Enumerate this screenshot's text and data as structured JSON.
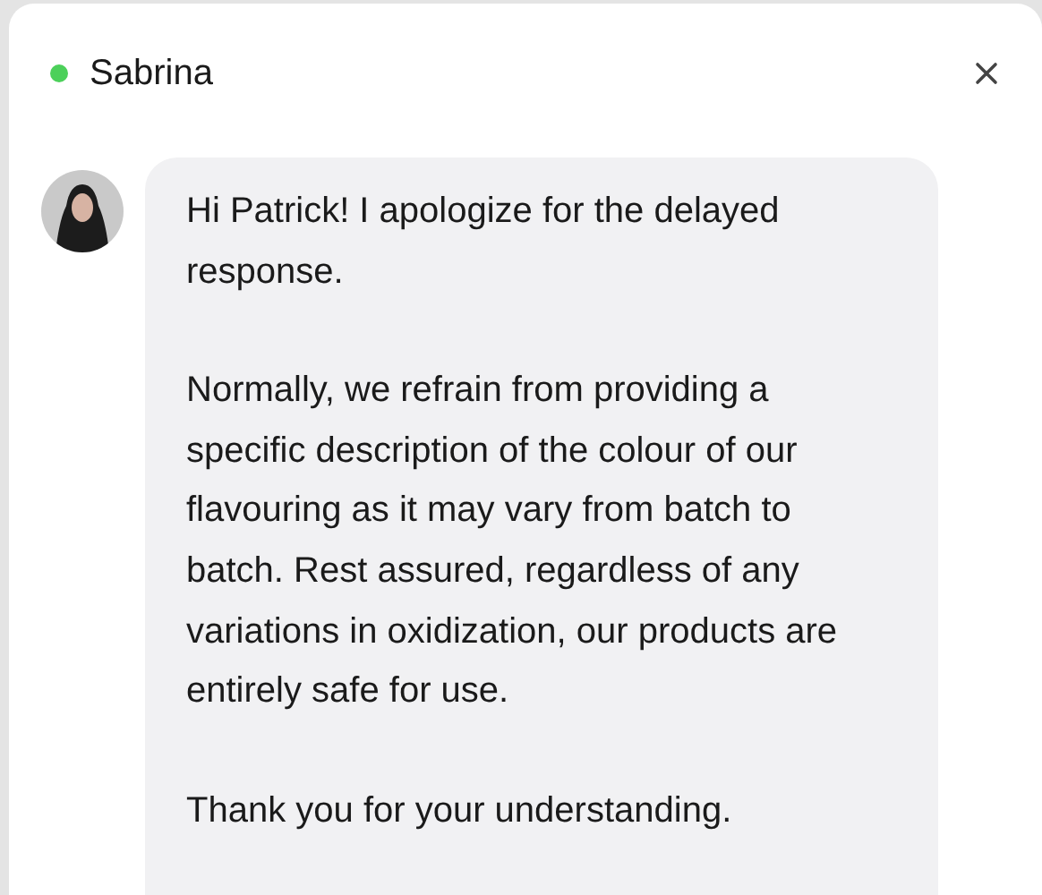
{
  "chat": {
    "contact": {
      "name": "Sabrina",
      "online": true
    },
    "messages": [
      {
        "paragraphs": [
          "Hi Patrick! I apologize for the delayed response.",
          "Normally, we refrain from providing a specific description of the colour of our flavouring as it may vary from batch to batch. Rest assured, regardless of any variations in oxidization, our products are entirely safe for use.",
          "Thank you for your understanding."
        ]
      }
    ]
  }
}
